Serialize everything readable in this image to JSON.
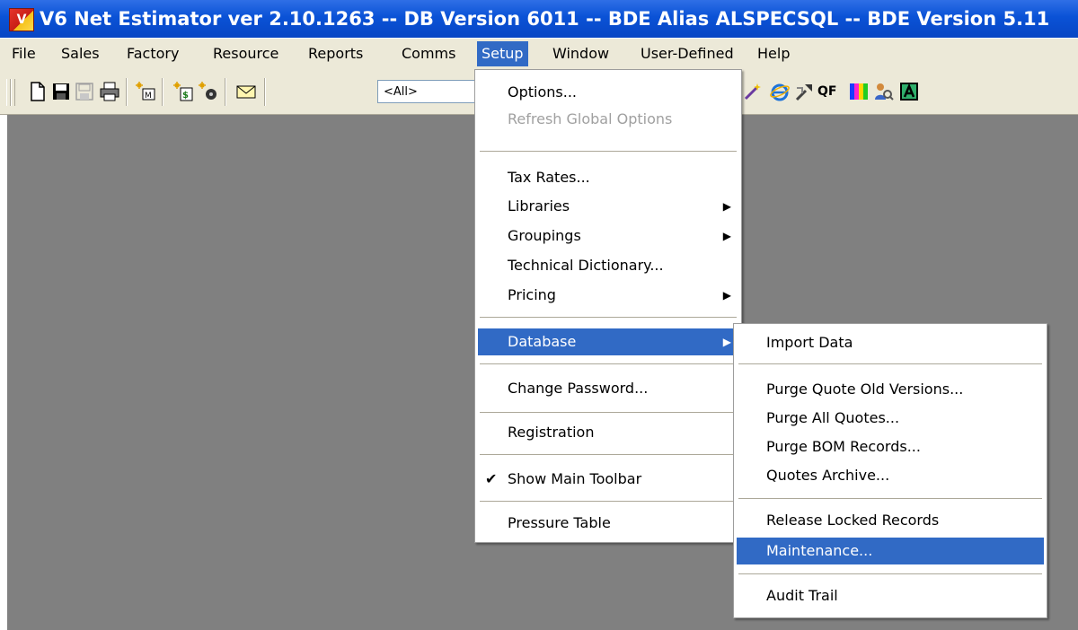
{
  "title_bar": {
    "text": "V6 Net Estimator ver 2.10.1263 -- DB Version 6011 -- BDE Alias ALSPECSQL -- BDE Version 5.11",
    "icon_letter": "V"
  },
  "menu_bar": {
    "items": [
      {
        "label": "File"
      },
      {
        "label": "Sales"
      },
      {
        "label": "Factory"
      },
      {
        "label": "Resource"
      },
      {
        "label": "Reports"
      },
      {
        "label": "Comms"
      },
      {
        "label": "Setup"
      },
      {
        "label": "Window"
      },
      {
        "label": "User-Defined"
      },
      {
        "label": "Help"
      }
    ],
    "active_item": "Setup"
  },
  "toolbar": {
    "combo_value": "<All>",
    "qf_label": "QF",
    "icon_names": [
      "new-document-icon",
      "save-icon",
      "save-disabled-icon",
      "print-icon",
      "sales-new-icon",
      "price-new-icon",
      "resource-icon",
      "mail-icon",
      "wand-icon",
      "internet-explorer-icon",
      "tools-icon",
      "qf-icon",
      "color-palette-icon",
      "user-search-icon",
      "a-letter-icon"
    ]
  },
  "setup_menu": {
    "items": [
      {
        "label": "Options..."
      },
      {
        "label": "Refresh Global Options",
        "disabled": true
      },
      {
        "label": "Tax Rates..."
      },
      {
        "label": "Libraries",
        "submenu": true
      },
      {
        "label": "Groupings",
        "submenu": true
      },
      {
        "label": "Technical Dictionary..."
      },
      {
        "label": "Pricing",
        "submenu": true
      },
      {
        "label": "Database",
        "submenu": true,
        "highlighted": true
      },
      {
        "label": "Change Password..."
      },
      {
        "label": "Registration"
      },
      {
        "label": "Show Main Toolbar",
        "checked": true
      },
      {
        "label": "Pressure Table"
      }
    ]
  },
  "database_submenu": {
    "items": [
      {
        "label": "Import Data"
      },
      {
        "label": "Purge Quote Old Versions..."
      },
      {
        "label": "Purge All Quotes..."
      },
      {
        "label": "Purge BOM Records..."
      },
      {
        "label": "Quotes Archive..."
      },
      {
        "label": "Release Locked Records"
      },
      {
        "label": "Maintenance...",
        "highlighted": true
      },
      {
        "label": "Audit Trail"
      }
    ]
  },
  "colors": {
    "title_bar": "#0a52d6",
    "menu_highlight": "#316ac5",
    "chrome": "#ece9d8",
    "workspace": "#808080"
  }
}
